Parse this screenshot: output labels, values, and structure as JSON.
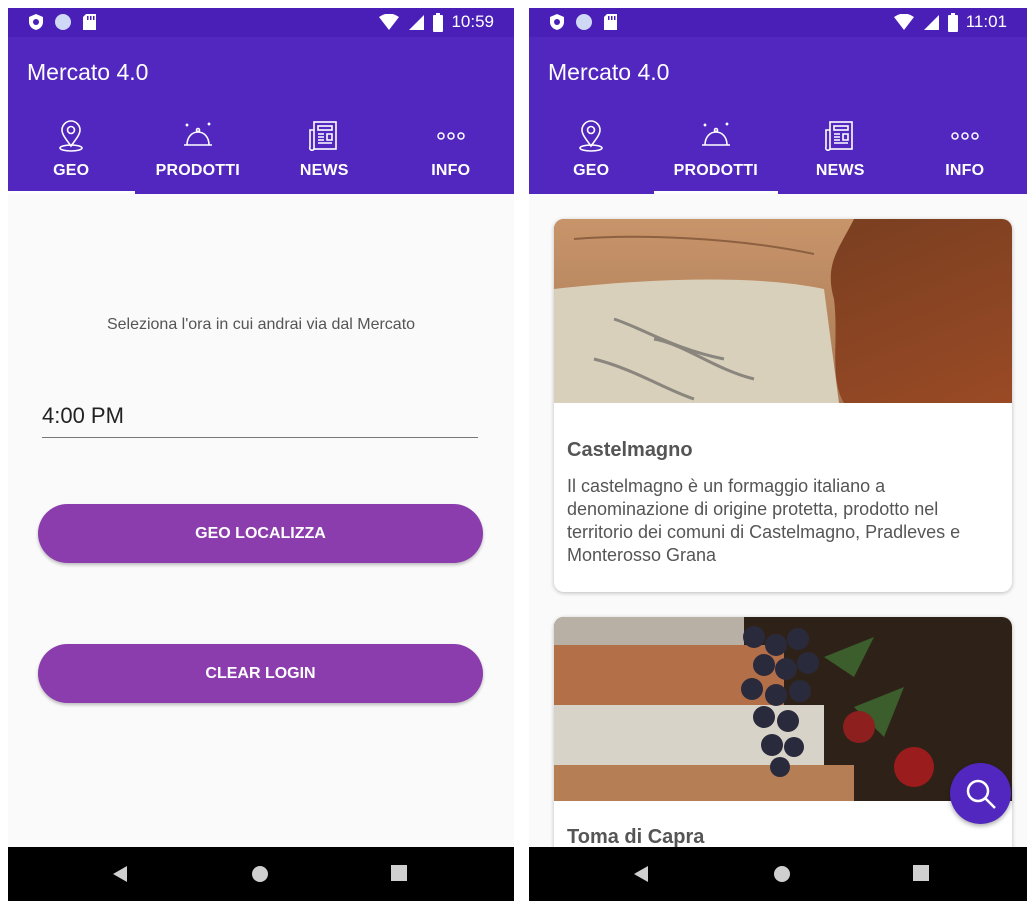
{
  "colors": {
    "status_bar": "#4a1fb8",
    "app_bar": "#5227bf",
    "button": "#8b3dad",
    "background": "#fafafa",
    "nav_bar": "#000000"
  },
  "left_screen": {
    "status": {
      "time": "10:59"
    },
    "app_title": "Mercato 4.0",
    "tabs": [
      {
        "label": "GEO",
        "icon": "map-pin-icon",
        "active": true
      },
      {
        "label": "PRODOTTI",
        "icon": "cloche-icon",
        "active": false
      },
      {
        "label": "NEWS",
        "icon": "newspaper-icon",
        "active": false
      },
      {
        "label": "INFO",
        "icon": "more-dots-icon",
        "active": false
      }
    ],
    "prompt": "Seleziona l'ora in cui andrai via dal Mercato",
    "time_value": "4:00 PM",
    "geo_button": "GEO LOCALIZZA",
    "clear_button": "CLEAR LOGIN"
  },
  "right_screen": {
    "status": {
      "time": "11:01"
    },
    "app_title": "Mercato 4.0",
    "tabs": [
      {
        "label": "GEO",
        "icon": "map-pin-icon",
        "active": false
      },
      {
        "label": "PRODOTTI",
        "icon": "cloche-icon",
        "active": true
      },
      {
        "label": "NEWS",
        "icon": "newspaper-icon",
        "active": false
      },
      {
        "label": "INFO",
        "icon": "more-dots-icon",
        "active": false
      }
    ],
    "products": [
      {
        "title": "Castelmagno",
        "description": "Il castelmagno è un formaggio italiano a denominazione di origine protetta, prodotto nel territorio dei comuni di Castelmagno, Pradleves e Monterosso Grana"
      },
      {
        "title": "Toma di Capra",
        "description": ""
      }
    ],
    "fab_icon": "search-icon"
  }
}
